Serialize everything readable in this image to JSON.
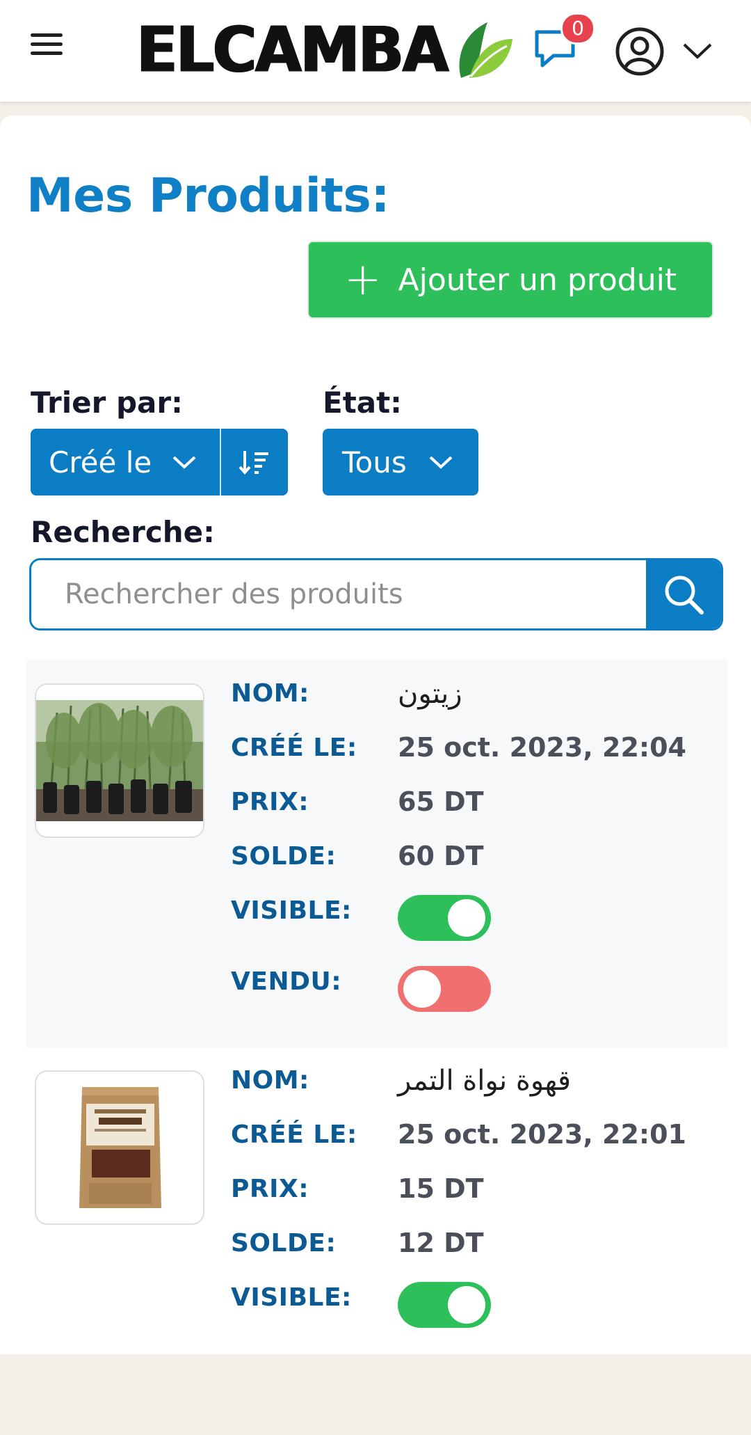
{
  "header": {
    "logo_text": "ELCAMBA",
    "notifications_count": "0"
  },
  "page": {
    "title": "Mes Produits:",
    "add_button_label": "Ajouter un produit",
    "sort_label": "Trier par:",
    "sort_value": "Créé le",
    "state_label": "État:",
    "state_value": "Tous",
    "search_label": "Recherche:",
    "search_placeholder": "Rechercher des produits"
  },
  "field_labels": {
    "name": "NOM:",
    "created": "CRÉÉ LE:",
    "price": "PRIX:",
    "sale": "SOLDE:",
    "visible": "VISIBLE:",
    "sold": "VENDU:"
  },
  "products": [
    {
      "name": "زيتون",
      "created": "25 oct. 2023, 22:04",
      "price": "65 DT",
      "sale": "60 DT",
      "visible": true,
      "sold": false
    },
    {
      "name": "قهوة نواة التمر",
      "created": "25 oct. 2023, 22:01",
      "price": "15 DT",
      "sale": "12 DT",
      "visible": true
    }
  ],
  "colors": {
    "primary_blue": "#0b7dc4",
    "title_blue": "#0f7fc6",
    "green": "#2dc05a",
    "red_toggle": "#f07070",
    "badge_red": "#e8424e"
  }
}
